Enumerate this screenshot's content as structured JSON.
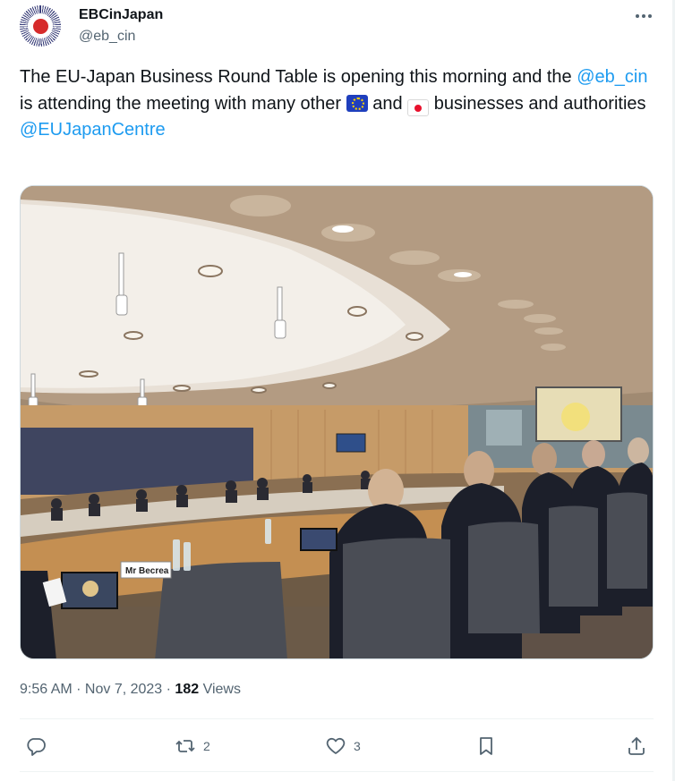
{
  "author": {
    "display_name": "EBCinJapan",
    "handle": "@eb_cin",
    "avatar_icon": "ebc-logo-avatar"
  },
  "tweet": {
    "text_part1": "The EU-Japan Business Round Table is opening this morning and the ",
    "mention1": "@eb_cin",
    "text_part2": " is attending the meeting with many other ",
    "flag_eu_icon": "eu-flag-emoji",
    "text_part3": " and ",
    "flag_jp_icon": "japan-flag-emoji",
    "text_part4": " businesses and authorities",
    "mention2": "@EUJapanCentre"
  },
  "photo": {
    "nameplate": "Mr Becrea"
  },
  "meta": {
    "time": "9:56 AM",
    "separator": " · ",
    "date": "Nov 7, 2023",
    "views_count": "182",
    "views_label": " Views"
  },
  "actions": {
    "reply_count": "",
    "retweet_count": "2",
    "like_count": "3"
  },
  "colors": {
    "link": "#1d9bf0",
    "text": "#0f1419",
    "secondary": "#536471"
  }
}
